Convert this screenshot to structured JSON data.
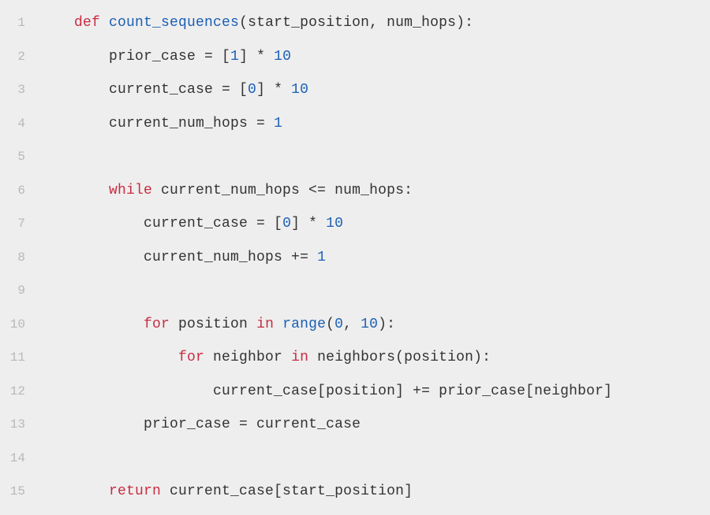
{
  "code": {
    "language": "python",
    "lines": [
      {
        "n": "1",
        "indent": "    ",
        "tokens": [
          {
            "t": "def ",
            "c": "kw"
          },
          {
            "t": "count_sequences",
            "c": "fn"
          },
          {
            "t": "(start_position, num_hops):",
            "c": "id"
          }
        ]
      },
      {
        "n": "2",
        "indent": "        ",
        "tokens": [
          {
            "t": "prior_case = [",
            "c": "id"
          },
          {
            "t": "1",
            "c": "num"
          },
          {
            "t": "] * ",
            "c": "id"
          },
          {
            "t": "10",
            "c": "num"
          }
        ]
      },
      {
        "n": "3",
        "indent": "        ",
        "tokens": [
          {
            "t": "current_case = [",
            "c": "id"
          },
          {
            "t": "0",
            "c": "num"
          },
          {
            "t": "] * ",
            "c": "id"
          },
          {
            "t": "10",
            "c": "num"
          }
        ]
      },
      {
        "n": "4",
        "indent": "        ",
        "tokens": [
          {
            "t": "current_num_hops = ",
            "c": "id"
          },
          {
            "t": "1",
            "c": "num"
          }
        ]
      },
      {
        "n": "5",
        "indent": "",
        "tokens": []
      },
      {
        "n": "6",
        "indent": "        ",
        "tokens": [
          {
            "t": "while ",
            "c": "kw"
          },
          {
            "t": "current_num_hops <= num_hops:",
            "c": "id"
          }
        ]
      },
      {
        "n": "7",
        "indent": "            ",
        "tokens": [
          {
            "t": "current_case = [",
            "c": "id"
          },
          {
            "t": "0",
            "c": "num"
          },
          {
            "t": "] * ",
            "c": "id"
          },
          {
            "t": "10",
            "c": "num"
          }
        ]
      },
      {
        "n": "8",
        "indent": "            ",
        "tokens": [
          {
            "t": "current_num_hops += ",
            "c": "id"
          },
          {
            "t": "1",
            "c": "num"
          }
        ]
      },
      {
        "n": "9",
        "indent": "",
        "tokens": []
      },
      {
        "n": "10",
        "indent": "            ",
        "tokens": [
          {
            "t": "for ",
            "c": "kw"
          },
          {
            "t": "position ",
            "c": "id"
          },
          {
            "t": "in ",
            "c": "kw"
          },
          {
            "t": "range",
            "c": "fn"
          },
          {
            "t": "(",
            "c": "id"
          },
          {
            "t": "0",
            "c": "num"
          },
          {
            "t": ", ",
            "c": "id"
          },
          {
            "t": "10",
            "c": "num"
          },
          {
            "t": "):",
            "c": "id"
          }
        ]
      },
      {
        "n": "11",
        "indent": "                ",
        "tokens": [
          {
            "t": "for ",
            "c": "kw"
          },
          {
            "t": "neighbor ",
            "c": "id"
          },
          {
            "t": "in ",
            "c": "kw"
          },
          {
            "t": "neighbors(position):",
            "c": "id"
          }
        ]
      },
      {
        "n": "12",
        "indent": "                    ",
        "tokens": [
          {
            "t": "current_case[position] += prior_case[neighbor]",
            "c": "id"
          }
        ]
      },
      {
        "n": "13",
        "indent": "            ",
        "tokens": [
          {
            "t": "prior_case = current_case",
            "c": "id"
          }
        ]
      },
      {
        "n": "14",
        "indent": "",
        "tokens": []
      },
      {
        "n": "15",
        "indent": "        ",
        "tokens": [
          {
            "t": "return ",
            "c": "kw"
          },
          {
            "t": "current_case[start_position]",
            "c": "id"
          }
        ]
      }
    ]
  }
}
